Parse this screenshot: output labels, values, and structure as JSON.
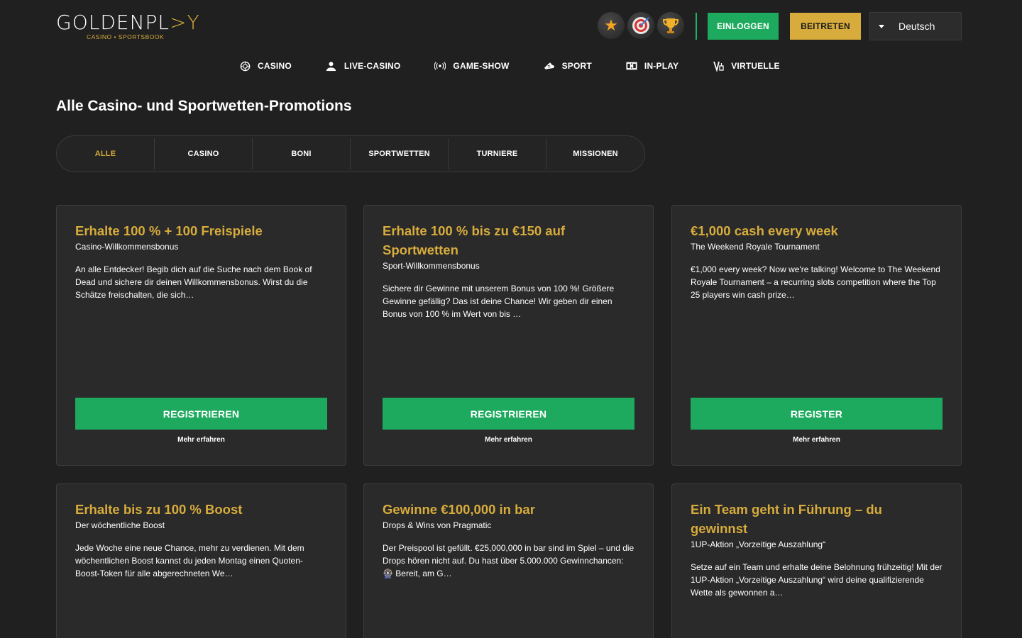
{
  "brand": {
    "logo_main_a": "GOLDENPL",
    "logo_main_b": ">Y",
    "logo_sub": "CASINO • SPORTSBOOK"
  },
  "header": {
    "login_label": "EINLOGGEN",
    "join_label": "BEITRETEN",
    "language": "Deutsch"
  },
  "nav": [
    {
      "label": "CASINO",
      "icon": "casino-chip-icon"
    },
    {
      "label": "LIVE-CASINO",
      "icon": "live-dealer-icon"
    },
    {
      "label": "GAME-SHOW",
      "icon": "broadcast-icon"
    },
    {
      "label": "SPORT",
      "icon": "sport-shoe-icon"
    },
    {
      "label": "IN-PLAY",
      "icon": "scoreboard-icon"
    },
    {
      "label": "VIRTUELLE",
      "icon": "virtual-icon"
    }
  ],
  "page": {
    "title": "Alle Casino- und Sportwetten-Promotions"
  },
  "filters": [
    {
      "label": "ALLE",
      "active": true
    },
    {
      "label": "CASINO"
    },
    {
      "label": "BONI"
    },
    {
      "label": "SPORTWETTEN"
    },
    {
      "label": "TURNIERE"
    },
    {
      "label": "MISSIONEN"
    }
  ],
  "promos": [
    {
      "title": "Erhalte 100 % + 100 Freispiele",
      "subtitle": "Casino-Willkommensbonus",
      "description": "An alle Entdecker! Begib dich auf die Suche nach dem Book of Dead und sichere dir deinen Willkommensbonus. Wirst du die Schätze freischalten, die sich…",
      "button": "REGISTRIEREN",
      "more": "Mehr erfahren"
    },
    {
      "title": "Erhalte 100 % bis zu €150 auf Sportwetten",
      "subtitle": "Sport-Willkommensbonus",
      "description": "Sichere dir Gewinne mit unserem Bonus von 100 %! Größere Gewinne gefällig? Das ist deine Chance! Wir geben dir einen Bonus von 100 % im Wert von bis …",
      "button": "REGISTRIEREN",
      "more": "Mehr erfahren"
    },
    {
      "title": "€1,000 cash every week",
      "subtitle": "The Weekend Royale Tournament",
      "description": "€1,000 every week? Now we're talking! Welcome to The Weekend Royale Tournament – a recurring slots competition where the Top 25 players win cash prize…",
      "button": "REGISTER",
      "more": "Mehr erfahren"
    },
    {
      "title": "Erhalte bis zu 100 % Boost",
      "subtitle": "Der wöchentliche Boost",
      "description": "Jede Woche eine neue Chance, mehr zu verdienen. Mit dem wöchentlichen Boost kannst du jeden Montag einen Quoten-Boost-Token für alle abgerechneten We…"
    },
    {
      "title": "Gewinne €100,000 in bar",
      "subtitle": "Drops & Wins von Pragmatic",
      "description": "Der Preispool ist gefüllt. €25,000,000 in bar sind im Spiel – und die Drops hören nicht auf.  Du hast über 5.000.000 Gewinnchancen:  🎡 Bereit, am G…"
    },
    {
      "title": "Ein Team geht in Führung – du gewinnst",
      "subtitle": "1UP-Aktion „Vorzeitige Auszahlung“",
      "description": "Setze auf ein Team und erhalte deine Belohnung frühzeitig! Mit der 1UP-Aktion „Vorzeitige Auszahlung“ wird deine qualifizierende Wette als gewonnen a…"
    }
  ],
  "colors": {
    "background": "#202020",
    "card": "#2a2a2a",
    "gold": "#d7ac3c",
    "green": "#1eaa5e"
  }
}
